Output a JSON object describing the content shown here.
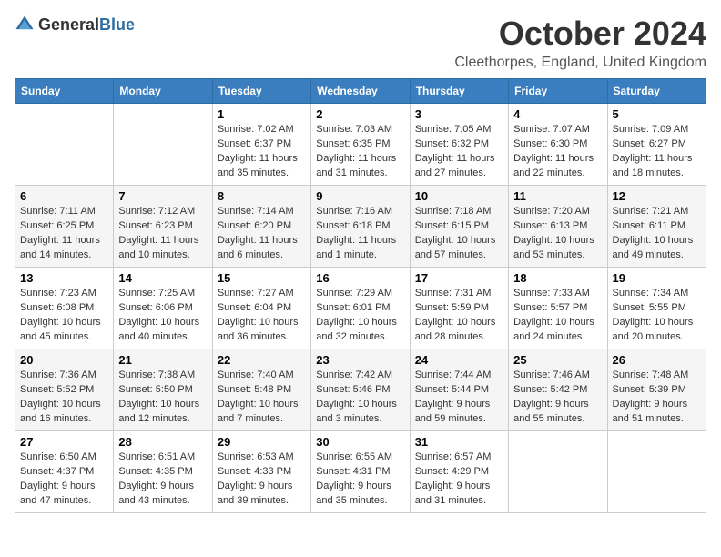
{
  "header": {
    "logo_general": "General",
    "logo_blue": "Blue",
    "month": "October 2024",
    "location": "Cleethorpes, England, United Kingdom"
  },
  "days_of_week": [
    "Sunday",
    "Monday",
    "Tuesday",
    "Wednesday",
    "Thursday",
    "Friday",
    "Saturday"
  ],
  "weeks": [
    [
      {
        "day": "",
        "content": ""
      },
      {
        "day": "",
        "content": ""
      },
      {
        "day": "1",
        "content": "Sunrise: 7:02 AM\nSunset: 6:37 PM\nDaylight: 11 hours and 35 minutes."
      },
      {
        "day": "2",
        "content": "Sunrise: 7:03 AM\nSunset: 6:35 PM\nDaylight: 11 hours and 31 minutes."
      },
      {
        "day": "3",
        "content": "Sunrise: 7:05 AM\nSunset: 6:32 PM\nDaylight: 11 hours and 27 minutes."
      },
      {
        "day": "4",
        "content": "Sunrise: 7:07 AM\nSunset: 6:30 PM\nDaylight: 11 hours and 22 minutes."
      },
      {
        "day": "5",
        "content": "Sunrise: 7:09 AM\nSunset: 6:27 PM\nDaylight: 11 hours and 18 minutes."
      }
    ],
    [
      {
        "day": "6",
        "content": "Sunrise: 7:11 AM\nSunset: 6:25 PM\nDaylight: 11 hours and 14 minutes."
      },
      {
        "day": "7",
        "content": "Sunrise: 7:12 AM\nSunset: 6:23 PM\nDaylight: 11 hours and 10 minutes."
      },
      {
        "day": "8",
        "content": "Sunrise: 7:14 AM\nSunset: 6:20 PM\nDaylight: 11 hours and 6 minutes."
      },
      {
        "day": "9",
        "content": "Sunrise: 7:16 AM\nSunset: 6:18 PM\nDaylight: 11 hours and 1 minute."
      },
      {
        "day": "10",
        "content": "Sunrise: 7:18 AM\nSunset: 6:15 PM\nDaylight: 10 hours and 57 minutes."
      },
      {
        "day": "11",
        "content": "Sunrise: 7:20 AM\nSunset: 6:13 PM\nDaylight: 10 hours and 53 minutes."
      },
      {
        "day": "12",
        "content": "Sunrise: 7:21 AM\nSunset: 6:11 PM\nDaylight: 10 hours and 49 minutes."
      }
    ],
    [
      {
        "day": "13",
        "content": "Sunrise: 7:23 AM\nSunset: 6:08 PM\nDaylight: 10 hours and 45 minutes."
      },
      {
        "day": "14",
        "content": "Sunrise: 7:25 AM\nSunset: 6:06 PM\nDaylight: 10 hours and 40 minutes."
      },
      {
        "day": "15",
        "content": "Sunrise: 7:27 AM\nSunset: 6:04 PM\nDaylight: 10 hours and 36 minutes."
      },
      {
        "day": "16",
        "content": "Sunrise: 7:29 AM\nSunset: 6:01 PM\nDaylight: 10 hours and 32 minutes."
      },
      {
        "day": "17",
        "content": "Sunrise: 7:31 AM\nSunset: 5:59 PM\nDaylight: 10 hours and 28 minutes."
      },
      {
        "day": "18",
        "content": "Sunrise: 7:33 AM\nSunset: 5:57 PM\nDaylight: 10 hours and 24 minutes."
      },
      {
        "day": "19",
        "content": "Sunrise: 7:34 AM\nSunset: 5:55 PM\nDaylight: 10 hours and 20 minutes."
      }
    ],
    [
      {
        "day": "20",
        "content": "Sunrise: 7:36 AM\nSunset: 5:52 PM\nDaylight: 10 hours and 16 minutes."
      },
      {
        "day": "21",
        "content": "Sunrise: 7:38 AM\nSunset: 5:50 PM\nDaylight: 10 hours and 12 minutes."
      },
      {
        "day": "22",
        "content": "Sunrise: 7:40 AM\nSunset: 5:48 PM\nDaylight: 10 hours and 7 minutes."
      },
      {
        "day": "23",
        "content": "Sunrise: 7:42 AM\nSunset: 5:46 PM\nDaylight: 10 hours and 3 minutes."
      },
      {
        "day": "24",
        "content": "Sunrise: 7:44 AM\nSunset: 5:44 PM\nDaylight: 9 hours and 59 minutes."
      },
      {
        "day": "25",
        "content": "Sunrise: 7:46 AM\nSunset: 5:42 PM\nDaylight: 9 hours and 55 minutes."
      },
      {
        "day": "26",
        "content": "Sunrise: 7:48 AM\nSunset: 5:39 PM\nDaylight: 9 hours and 51 minutes."
      }
    ],
    [
      {
        "day": "27",
        "content": "Sunrise: 6:50 AM\nSunset: 4:37 PM\nDaylight: 9 hours and 47 minutes."
      },
      {
        "day": "28",
        "content": "Sunrise: 6:51 AM\nSunset: 4:35 PM\nDaylight: 9 hours and 43 minutes."
      },
      {
        "day": "29",
        "content": "Sunrise: 6:53 AM\nSunset: 4:33 PM\nDaylight: 9 hours and 39 minutes."
      },
      {
        "day": "30",
        "content": "Sunrise: 6:55 AM\nSunset: 4:31 PM\nDaylight: 9 hours and 35 minutes."
      },
      {
        "day": "31",
        "content": "Sunrise: 6:57 AM\nSunset: 4:29 PM\nDaylight: 9 hours and 31 minutes."
      },
      {
        "day": "",
        "content": ""
      },
      {
        "day": "",
        "content": ""
      }
    ]
  ]
}
